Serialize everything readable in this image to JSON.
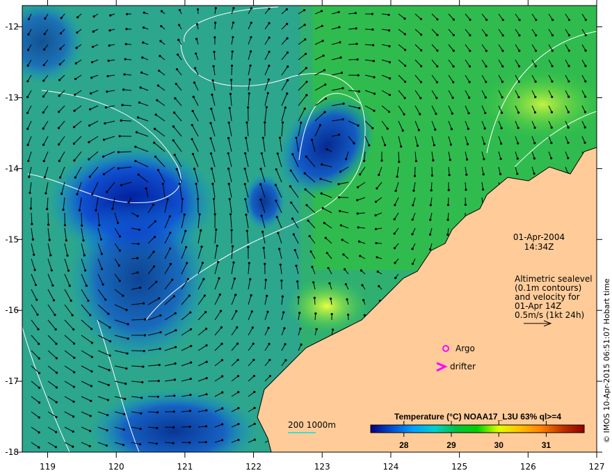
{
  "map": {
    "longitude_ticks": [
      "119",
      "120",
      "121",
      "122",
      "123",
      "124",
      "125",
      "126",
      "127"
    ],
    "latitude_ticks": [
      "-12",
      "-13",
      "-14",
      "-15",
      "-16",
      "-17",
      "-18"
    ],
    "lon_range": [
      118.63,
      127
    ],
    "lat_range": [
      -18,
      -11.7
    ]
  },
  "annotation": {
    "date": "01-Apr-2004",
    "time": "14:34Z",
    "lines": [
      "Altimetric sealevel",
      "(0.1m contours)",
      "and velocity for",
      "01-Apr 14Z",
      "0.5m/s (1kt 24h)"
    ]
  },
  "legend": {
    "argo": "Argo",
    "drifter": "drifter",
    "depth_scale": "200  1000m",
    "argo_color": "#ff00ff",
    "depth_line_color": "#00e0e0"
  },
  "colorbar": {
    "title": "Temperature (°C) NOAA17_L3U 63% ql>=4",
    "ticks": [
      "28",
      "29",
      "30",
      "31"
    ],
    "range": [
      27.3,
      31.8
    ],
    "colors": [
      "#000080",
      "#0050d0",
      "#00a0ff",
      "#00d0d0",
      "#00c040",
      "#00d000",
      "#e0ff00",
      "#ffc000",
      "#ff8000",
      "#c03000",
      "#900000"
    ]
  },
  "credit": "© IMOS 10-Apr-2015 06:51:07 Hobart time",
  "colors": {
    "land": "#ffcc99",
    "contour": "#ffffff",
    "arrow": "#000000"
  }
}
